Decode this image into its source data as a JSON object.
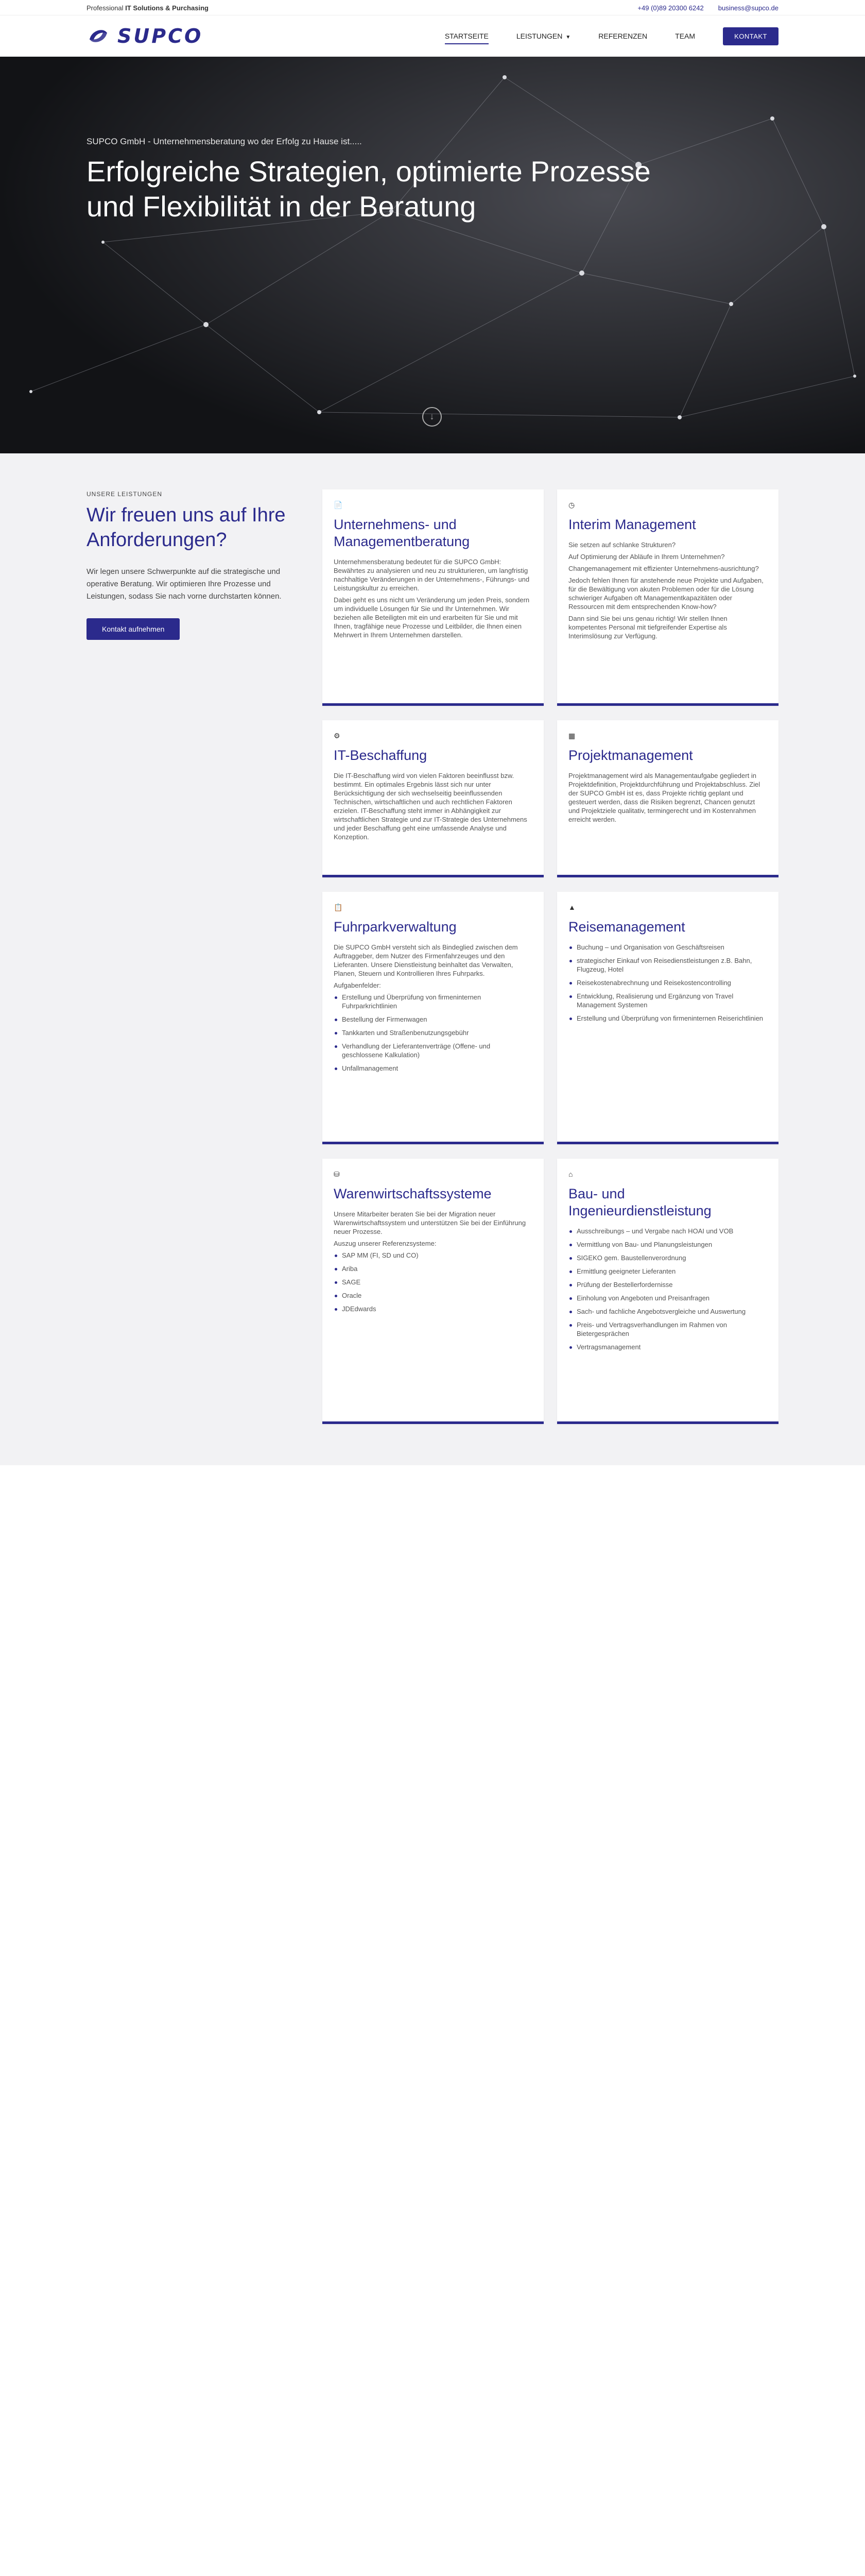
{
  "topbar": {
    "tagline_pre": "Professional ",
    "tagline_bold": "IT Solutions & Purchasing",
    "phone": "+49 (0)89 20300 6242",
    "email": "business@supco.de"
  },
  "brand": {
    "name": "SUPCO",
    "accent": "#2b2a8c"
  },
  "nav": {
    "items": [
      {
        "label": "STARTSEITE"
      },
      {
        "label": "LEISTUNGEN"
      },
      {
        "label": "REFERENZEN"
      },
      {
        "label": "TEAM"
      }
    ],
    "cta": "KONTAKT",
    "caret": "chevron-down-icon"
  },
  "hero": {
    "pre": "SUPCO GmbH - Unternehmensberatung wo der Erfolg zu Hause ist.....",
    "title": "Erfolgreiche Strategien, optimierte Prozesse und Flexibilität in der Beratung"
  },
  "services": {
    "eyebrow": "UNSERE LEISTUNGEN",
    "title": "Wir freuen uns auf Ihre Anforderungen?",
    "text": "Wir legen unsere Schwerpunkte auf die strategische und operative Beratung. Wir optimieren Ihre Prozesse und Leistungen, sodass Sie nach vorne durchstarten können.",
    "button": "Kontakt aufnehmen",
    "cards": [
      {
        "title": "Unternehmens- und Managementberatung",
        "p": [
          "Unternehmensberatung bedeutet für die SUPCO GmbH: Bewährtes zu analysieren und neu zu strukturieren, um langfristig nachhaltige Veränderungen in der Unternehmens-, Führungs- und Leistungskultur zu erreichen.",
          "Dabei geht es uns nicht um Veränderung um jeden Preis, sondern um individuelle Lösungen für Sie und Ihr Unternehmen. Wir beziehen alle Beteiligten mit ein und erarbeiten für Sie und mit Ihnen, tragfähige neue Prozesse und Leitbilder, die Ihnen einen Mehrwert in Ihrem Unternehmen darstellen."
        ]
      },
      {
        "title": "Interim Management",
        "p": [
          "Sie setzen auf schlanke Strukturen?",
          "Auf Optimierung der Abläufe in Ihrem Unternehmen?",
          "Changemanagement mit effizienter Unternehmens-ausrichtung?",
          "Jedoch fehlen Ihnen für anstehende neue Projekte und Aufgaben, für die Bewältigung von akuten Problemen oder für die Lösung schwieriger Aufgaben oft Managementkapazitäten oder Ressourcen mit dem entsprechenden Know-how?",
          "Dann sind Sie bei uns genau richtig! Wir stellen Ihnen kompetentes Personal mit tiefgreifender Expertise als Interimslösung zur Verfügung."
        ]
      },
      {
        "title": "IT-Beschaffung",
        "p": [
          "Die IT-Beschaffung wird von vielen Faktoren beeinflusst bzw. bestimmt. Ein optimales Ergebnis lässt sich nur unter Berücksichtigung der sich wechselseitig beeinflussenden Technischen, wirtschaftlichen und auch rechtlichen Faktoren erzielen. IT-Beschaffung steht immer in Abhängigkeit zur wirtschaftlichen Strategie und zur IT-Strategie des Unternehmens und jeder Beschaffung geht eine umfassende Analyse und Konzeption."
        ]
      },
      {
        "title": "Projektmanagement",
        "p": [
          "Projektmanagement wird als Managementaufgabe gegliedert in Projektdefinition, Projektdurchführung und Projektabschluss. Ziel der SUPCO GmbH ist es, dass Projekte richtig geplant und gesteuert werden, dass die Risiken begrenzt, Chancen genutzt und Projektziele qualitativ, termingerecht und im Kostenrahmen erreicht werden."
        ]
      },
      {
        "title": "Fuhrparkverwaltung",
        "p": [
          "Die SUPCO GmbH versteht sich als Bindeglied zwischen dem Auftraggeber, dem Nutzer des Firmenfahrzeuges und den Lieferanten. Unsere Dienstleistung beinhaltet das Verwalten, Planen, Steuern und Kontrollieren Ihres Fuhrparks.",
          "Aufgabenfelder:"
        ],
        "list": [
          "Erstellung und Überprüfung von firmeninternen Fuhrparkrichtlinien",
          "Bestellung der Firmenwagen",
          "Tankkarten und Straßenbenutzungsgebühr",
          "Verhandlung der Lieferantenverträge (Offene- und geschlossene Kalkulation)",
          "Unfallmanagement"
        ]
      },
      {
        "title": "Reisemanagement",
        "list": [
          "Buchung – und Organisation von Geschäftsreisen",
          "strategischer Einkauf von Reisedienstleistungen z.B. Bahn, Flugzeug, Hotel",
          "Reisekostenabrechnung und Reisekostencontrolling",
          "Entwicklung, Realisierung und Ergänzung von Travel Management Systemen",
          "Erstellung und Überprüfung von firmeninternen Reiserichtlinien"
        ]
      },
      {
        "title": "Warenwirtschaftssysteme",
        "p": [
          "Unsere Mitarbeiter beraten Sie bei der Migration neuer Warenwirtschaftssystem und unterstützen Sie bei der Einführung neuer Prozesse.",
          "Auszug unserer Referenzsysteme:"
        ],
        "list": [
          "SAP MM (FI, SD und CO)",
          "Ariba",
          "SAGE",
          "Oracle",
          "JDEdwards"
        ]
      },
      {
        "title": "Bau- und Ingenieurdienstleistung",
        "list": [
          "Ausschreibungs – und Vergabe nach HOAI und VOB",
          "Vermittlung von Bau- und Planungsleistungen",
          "SIGEKO gem. Baustellenverordnung",
          "Ermittlung geeigneter Lieferanten",
          "Prüfung der Bestellerfordernisse",
          "Einholung von Angeboten und Preisanfragen",
          "Sach- und fachliche Angebotsvergleiche und Auswertung",
          "Preis- und Vertragsverhandlungen im Rahmen von Bietergesprächen",
          "Vertragsmanagement"
        ]
      }
    ]
  }
}
